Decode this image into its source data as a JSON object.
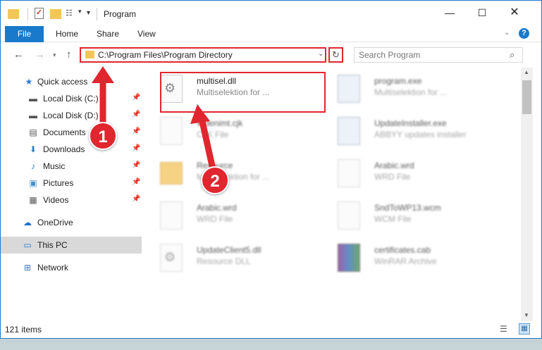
{
  "window": {
    "title": "Program",
    "controls": {
      "minimize": "—",
      "maximize": "☐",
      "close": "✕"
    }
  },
  "ribbon": {
    "tabs": [
      "File",
      "Home",
      "Share",
      "View"
    ]
  },
  "navbar": {
    "address": "C:\\Program Files\\Program Directory",
    "search_placeholder": "Search Program"
  },
  "nav_pane": {
    "items": [
      {
        "label": "Quick access",
        "icon": "star-icon",
        "pinned": false
      },
      {
        "label": "Local Disk (C:)",
        "icon": "drive-icon",
        "pinned": true
      },
      {
        "label": "Local Disk (D:)",
        "icon": "drive-icon",
        "pinned": true
      },
      {
        "label": "Documents",
        "icon": "documents-icon",
        "pinned": true
      },
      {
        "label": "Downloads",
        "icon": "downloads-icon",
        "pinned": true
      },
      {
        "label": "Music",
        "icon": "music-icon",
        "pinned": true
      },
      {
        "label": "Pictures",
        "icon": "pictures-icon",
        "pinned": true
      },
      {
        "label": "Videos",
        "icon": "videos-icon",
        "pinned": true
      },
      {
        "label": "OneDrive",
        "icon": "onedrive-icon",
        "pinned": false
      },
      {
        "label": "This PC",
        "icon": "this-pc-icon",
        "pinned": false,
        "selected": true
      },
      {
        "label": "Network",
        "icon": "network-icon",
        "pinned": false
      }
    ]
  },
  "files": [
    {
      "name": "multisel.dll",
      "type": "Multiselektion for ...",
      "icon": "gear-file-icon",
      "highlighted": true
    },
    {
      "name": "program.exe",
      "type": "Multiselektion for ...",
      "icon": "exe-icon"
    },
    {
      "name": "Wdenimt.cjk",
      "type": "CJK File",
      "icon": "file-icon"
    },
    {
      "name": "UpdateInstaller.exe",
      "type": "ABBYY updates installer",
      "icon": "exe-icon"
    },
    {
      "name": "Resource",
      "type": "Multiselektion for ...",
      "icon": "folder-icon"
    },
    {
      "name": "Arabic.wrd",
      "type": "WRD File",
      "icon": "file-icon"
    },
    {
      "name": "Arabic.wrd",
      "type": "WRD File",
      "icon": "file-icon"
    },
    {
      "name": "SndToWP13.wcm",
      "type": "WCM File",
      "icon": "file-icon"
    },
    {
      "name": "UpdateClient5.dll",
      "type": "Resource DLL",
      "icon": "gear-file-icon"
    },
    {
      "name": "certificates.cab",
      "type": "WinRAR Archive",
      "icon": "rar-icon"
    }
  ],
  "statusbar": {
    "item_count": "121 items"
  },
  "annotations": {
    "step1": "1",
    "step2": "2",
    "color": "#e0262e"
  }
}
